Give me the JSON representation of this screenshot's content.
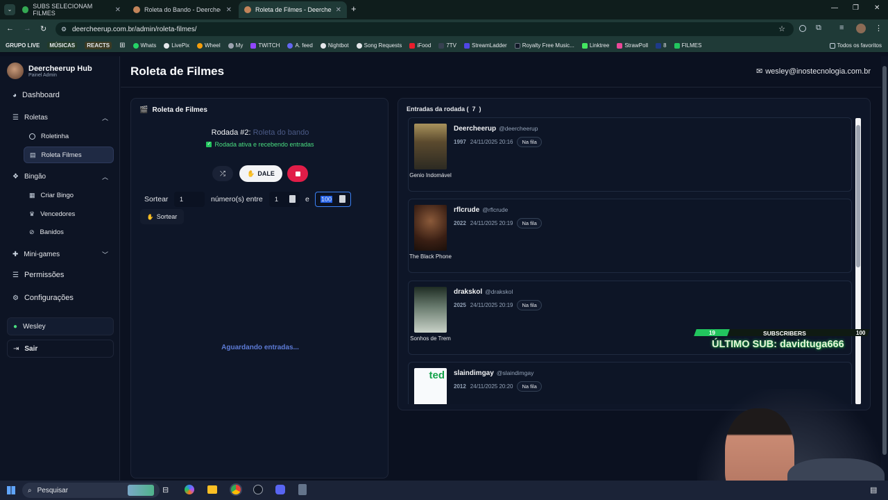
{
  "browser": {
    "tabs": [
      {
        "title": "SUBS SELECIONAM FILMES",
        "active": false
      },
      {
        "title": "Roleta do Bando - Deercheerup",
        "active": false
      },
      {
        "title": "Roleta de Filmes - Deercheerup",
        "active": true
      }
    ],
    "url": "deercheerup.com.br/admin/roleta-filmes/",
    "bookmarks": [
      "GRUPO LIVE",
      "MÚSICAS",
      "REACTS",
      "Whats",
      "LivePix",
      "Wheel",
      "My",
      "TWITCH",
      "A. feed",
      "Nightbot",
      "Song Requests",
      "iFood",
      "7TV",
      "StreamLadder",
      "Royalty Free Music...",
      "Linktree",
      "StrawPoll",
      "8",
      "FILMES"
    ],
    "all_bookmarks": "Todos os favoritos"
  },
  "sidebar": {
    "brand": "Deercheerup Hub",
    "brand_sub": "Painel Admin",
    "items": {
      "dashboard": "Dashboard",
      "roletas": "Roletas",
      "roletinha": "Roletinha",
      "roleta_filmes": "Roleta Filmes",
      "bingao": "Bingão",
      "criar_bingo": "Criar Bingo",
      "vencedores": "Vencedores",
      "banidos": "Banidos",
      "mini_games": "Mini-games",
      "permissoes": "Permissões",
      "configuracoes": "Configurações"
    },
    "user": "Wesley",
    "logout": "Sair"
  },
  "header": {
    "title": "Roleta de Filmes",
    "email": "wesley@inostecnologia.com.br"
  },
  "roleta_panel": {
    "title": "Roleta de Filmes",
    "round_label": "Rodada #2:",
    "round_name": "Roleta do bando",
    "status": "Rodada ativa e recebendo entradas",
    "dale_label": "DALE",
    "sortear_label": "Sortear",
    "sortear_value": "1",
    "numeros_entre": "número(s) entre",
    "min_value": "1",
    "e_label": "e",
    "max_value": "100",
    "sortear_button": "Sortear",
    "waiting": "Aguardando entradas..."
  },
  "entries": {
    "title": "Entradas da rodada (",
    "count": "7",
    "close": ")",
    "items": [
      {
        "name": "Deercheerup",
        "handle": "@deercheerup",
        "year": "1997",
        "datetime": "24/11/2025 20:16",
        "status": "Na fila",
        "movie": "Genio Indomável",
        "poster_color": "#4b5a3a"
      },
      {
        "name": "rflcrude",
        "handle": "@rflcrude",
        "year": "2022",
        "datetime": "24/11/2025 20:19",
        "status": "Na fila",
        "movie": "The Black Phone",
        "poster_color": "#5a3a2a"
      },
      {
        "name": "drakskol",
        "handle": "@drakskol",
        "year": "2025",
        "datetime": "24/11/2025 20:19",
        "status": "Na fila",
        "movie": "Sonhos de Trem",
        "poster_color": "#3d4a44"
      },
      {
        "name": "slaindimgay",
        "handle": "@slaindimgay",
        "year": "2012",
        "datetime": "24/11/2025 20:20",
        "status": "Na fila",
        "movie": "ted",
        "poster_color": "#ffffff"
      }
    ]
  },
  "overlay": {
    "left_num": "19",
    "label": "SUBSCRIBERS",
    "right_num": "100",
    "progress": 0.19,
    "last_sub": "ÚLTIMO SUB: davidtuga666"
  },
  "taskbar": {
    "search": "Pesquisar"
  }
}
